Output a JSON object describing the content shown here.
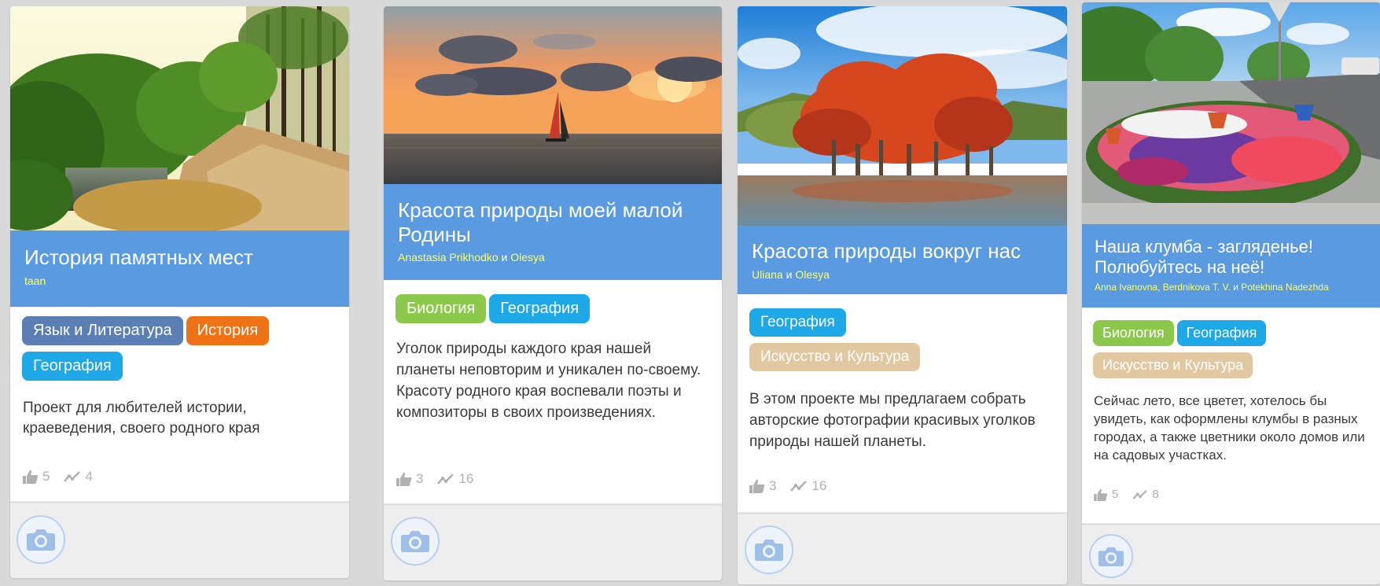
{
  "cards": [
    {
      "title": "История памятных мест",
      "authors": [
        "taan"
      ],
      "author_separator": "",
      "tags": [
        "Язык и Литература",
        "История",
        "География"
      ],
      "description": "Проект для любителей истории, краеведения, своего родного края",
      "likes": "5",
      "views": "4"
    },
    {
      "title": "Красота природы моей малой Родины",
      "authors": [
        "Anastasia Prikhodko",
        "Olesya"
      ],
      "author_separator": "и",
      "tags": [
        "Биология",
        "География"
      ],
      "description": "Уголок природы каждого края нашей планеты неповторим и уникален по-своему. Красоту родного края воспевали поэты и композиторы в своих произведениях.",
      "likes": "3",
      "views": "16"
    },
    {
      "title": "Красота природы вокруг нас",
      "authors": [
        "Uliana",
        "Olesya"
      ],
      "author_separator": "и",
      "tags": [
        "География",
        "Искусство и Культура"
      ],
      "description": "В этом проекте мы предлагаем собрать авторские фотографии красивых уголков природы нашей планеты.",
      "likes": "3",
      "views": "16"
    },
    {
      "title": "Наша клумба - загляденье! Полюбуйтесь на неё!",
      "authors": [
        "Anna Ivanovna",
        "Berdnikova T. V.",
        "Potekhina Nadezhda"
      ],
      "author_separator": "и",
      "author_list_separator": ",",
      "tags": [
        "Биология",
        "География",
        "Искусство и Культура"
      ],
      "description": "Сейчас лето, все цветет, хотелось бы увидеть, как оформлены клумбы в разных городах, а также цветники около домов или на садовых участках.",
      "likes": "5",
      "views": "8"
    }
  ],
  "tag_colors": {
    "Язык и Литература": "#5b7fb4",
    "История": "#ef7316",
    "География": "#1ea8e8",
    "Биология": "#8cc84b",
    "Искусство и Культура": "#e2c8a0"
  },
  "colors": {
    "header": "#5a9ae0",
    "author_link": "#ffff66"
  },
  "icons": {
    "likes": "thumbs-up-icon",
    "views": "trend-line-icon",
    "camera": "camera-icon"
  }
}
